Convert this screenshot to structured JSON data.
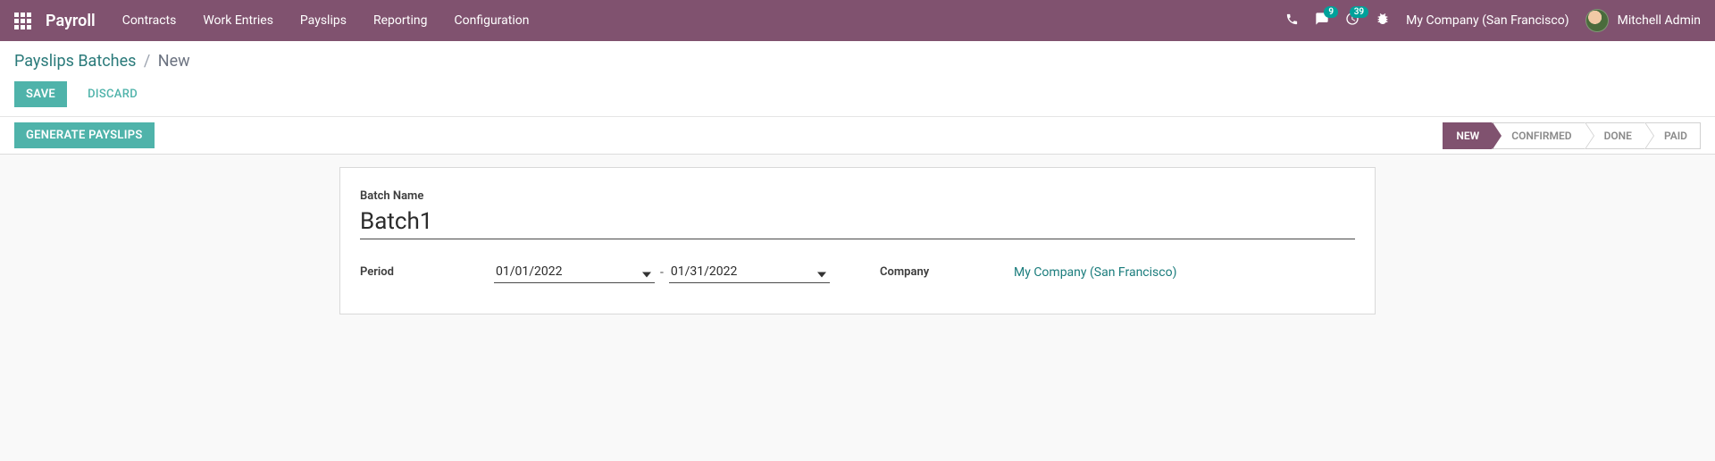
{
  "navbar": {
    "brand": "Payroll",
    "menu": [
      "Contracts",
      "Work Entries",
      "Payslips",
      "Reporting",
      "Configuration"
    ],
    "messages_count": "9",
    "activities_count": "39",
    "company": "My Company (San Francisco)",
    "username": "Mitchell Admin"
  },
  "breadcrumb": {
    "parent": "Payslips Batches",
    "current": "New"
  },
  "buttons": {
    "save": "Save",
    "discard": "Discard",
    "generate": "Generate Payslips"
  },
  "statusbar": {
    "steps": [
      "New",
      "Confirmed",
      "Done",
      "Paid"
    ],
    "active_index": 0
  },
  "form": {
    "batch_name_label": "Batch Name",
    "batch_name_value": "Batch1",
    "period_label": "Period",
    "date_from": "01/01/2022",
    "date_to": "01/31/2022",
    "company_label": "Company",
    "company_value": "My Company (San Francisco)"
  }
}
